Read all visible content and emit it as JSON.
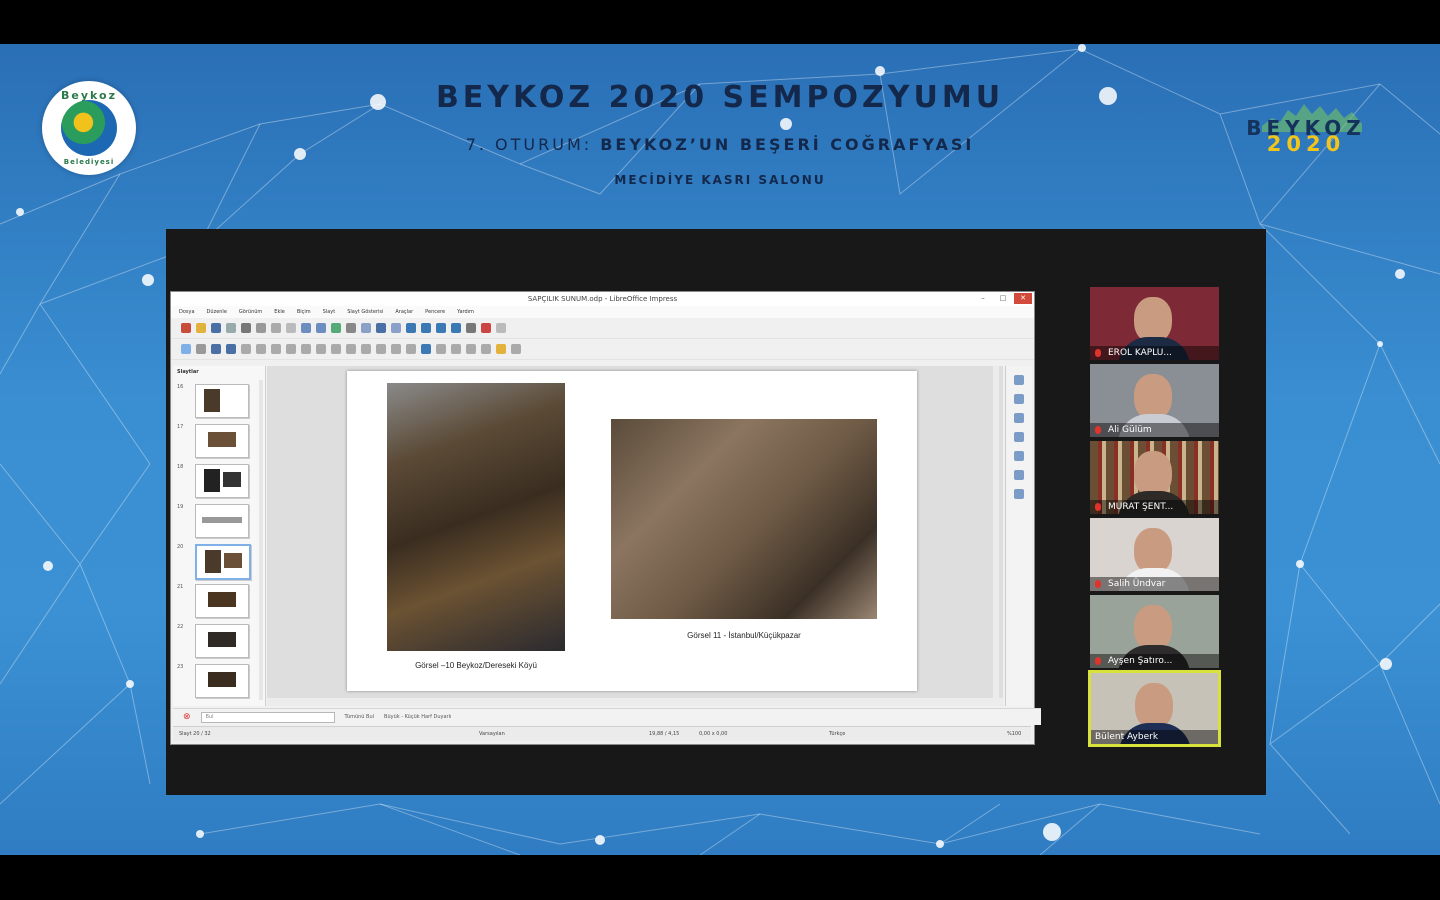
{
  "header": {
    "title": "BEYKOZ 2020 SEMPOZYUMU",
    "session_prefix": "7. OTURUM:",
    "session_topic": "BEYKOZ’UN BEŞERİ COĞRAFYASI",
    "venue": "MECİDİYE KASRI SALONU"
  },
  "logo_left": {
    "brand": "Beykoz",
    "sub": "Belediyesi"
  },
  "logo_right": {
    "line1": "BEYKOZ",
    "line2": "2020"
  },
  "impress": {
    "window_title": "SAPÇILIK SUNUM.odp - LibreOffice Impress",
    "menu": [
      "Dosya",
      "Düzenle",
      "Görünüm",
      "Ekle",
      "Biçim",
      "Slayt",
      "Slayt Gösterisi",
      "Araçlar",
      "Pencere",
      "Yardım"
    ],
    "panel_title": "Slaytlar",
    "thumbnails": [
      "16",
      "17",
      "18",
      "19",
      "20",
      "21",
      "22",
      "23"
    ],
    "caption1": "Görsel –10 Beykoz/Dereseki Köyü",
    "caption2": "Görsel 11 - İstanbul/Küçükpazar",
    "find_placeholder": "Bul",
    "find_all": "Tümünü Bul",
    "match_case": "Büyük - Küçük Harf Duyarlı",
    "status": {
      "slide": "Slayt 20 / 32",
      "layout": "Varsayılan",
      "position": "19,88 / 4,15",
      "size": "0,00 x 0,00",
      "language": "Türkçe",
      "zoom": "%100"
    }
  },
  "participants": [
    {
      "name": "EROL KAPLU...",
      "bg": "#7d2a36",
      "shirt": "#1c2a44"
    },
    {
      "name": "Ali Gülüm",
      "bg": "#8a8f96",
      "shirt": "#c9ccd2"
    },
    {
      "name": "MURAT ŞENT...",
      "bg": "#6b4f35",
      "shirt": "#2e2a28"
    },
    {
      "name": "Salih Ündvar",
      "bg": "#d9d4cf",
      "shirt": "#f2f2f2"
    },
    {
      "name": "Ayşen Şatıro...",
      "bg": "#9aa39a",
      "shirt": "#2d2b2c"
    },
    {
      "name": "Bülent Ayberk",
      "bg": "#c7c2b8",
      "shirt": "#1f2e55",
      "active": true
    }
  ],
  "colors": {
    "accent_active": "#d9e23b",
    "title": "#13284a",
    "logo_yellow": "#f2c518"
  }
}
